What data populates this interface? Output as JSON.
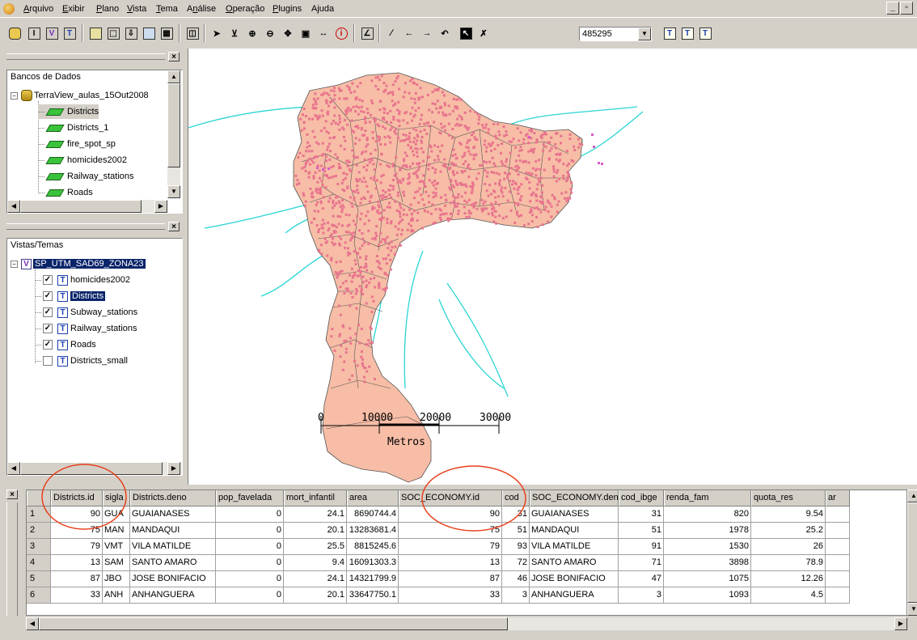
{
  "menu": [
    {
      "label": "Arquivo",
      "u": "A"
    },
    {
      "label": "Exibir",
      "u": "E"
    },
    {
      "label": "Plano",
      "u": "P"
    },
    {
      "label": "Vista",
      "u": "V"
    },
    {
      "label": "Tema",
      "u": "T"
    },
    {
      "label": "Análise",
      "u": "n"
    },
    {
      "label": "Operação",
      "u": "O"
    },
    {
      "label": "Plugins",
      "u": "P"
    },
    {
      "label": "Ajuda",
      "u": "j"
    }
  ],
  "window_controls": {
    "minimize": "_",
    "restore": "▫"
  },
  "toolbar": {
    "scale_value": "485295"
  },
  "database_panel": {
    "title": "Bancos de Dados",
    "database": "TerraView_aulas_15Out2008",
    "layers": [
      "Districts",
      "Districts_1",
      "fire_spot_sp",
      "homicides2002",
      "Railway_stations",
      "Roads"
    ]
  },
  "views_panel": {
    "title": "Vistas/Temas",
    "view": "SP_UTM_SAD69_ZONA23",
    "themes": [
      {
        "name": "homicides2002",
        "checked": true
      },
      {
        "name": "Districts",
        "checked": true
      },
      {
        "name": "Subway_stations",
        "checked": true
      },
      {
        "name": "Railway_stations",
        "checked": true
      },
      {
        "name": "Roads",
        "checked": true
      },
      {
        "name": "Districts_small",
        "checked": false
      }
    ]
  },
  "scale_bar": {
    "ticks": [
      "0",
      "10000",
      "20000",
      "30000"
    ],
    "unit": "Metros"
  },
  "colors": {
    "district_fill": "#f7bda6",
    "point_color": "#e8748e",
    "road_color": "#2ad4d4",
    "selection": "#0a246a",
    "annotation_circle": "#e8401c"
  },
  "table": {
    "columns": [
      "Districts.id",
      "sigla",
      "Districts.deno",
      "pop_favelada",
      "mort_infantil",
      "area",
      "SOC_ECONOMY.id",
      "cod",
      "SOC_ECONOMY.deno",
      "cod_ibge",
      "renda_fam",
      "quota_res",
      "ar"
    ],
    "rows": [
      {
        "n": "1",
        "cells": [
          "90",
          "GUA",
          "GUAIANASES",
          "0",
          "24.1",
          "8690744.4",
          "90",
          "31",
          "GUAIANASES",
          "31",
          "820",
          "9.54",
          ""
        ]
      },
      {
        "n": "2",
        "cells": [
          "75",
          "MAN",
          "MANDAQUI",
          "0",
          "20.1",
          "13283681.4",
          "75",
          "51",
          "MANDAQUI",
          "51",
          "1978",
          "25.2",
          ""
        ]
      },
      {
        "n": "3",
        "cells": [
          "79",
          "VMT",
          "VILA MATILDE",
          "0",
          "25.5",
          "8815245.6",
          "79",
          "93",
          "VILA MATILDE",
          "91",
          "1530",
          "26",
          ""
        ]
      },
      {
        "n": "4",
        "cells": [
          "13",
          "SAM",
          "SANTO AMARO",
          "0",
          "9.4",
          "16091303.3",
          "13",
          "72",
          "SANTO AMARO",
          "71",
          "3898",
          "78.9",
          ""
        ]
      },
      {
        "n": "5",
        "cells": [
          "87",
          "JBO",
          "JOSE BONIFACIO",
          "0",
          "24.1",
          "14321799.9",
          "87",
          "46",
          "JOSE BONIFACIO",
          "47",
          "1075",
          "12.26",
          ""
        ]
      },
      {
        "n": "6",
        "cells": [
          "33",
          "ANH",
          "ANHANGUERA",
          "0",
          "20.1",
          "33647750.1",
          "33",
          "3",
          "ANHANGUERA",
          "3",
          "1093",
          "4.5",
          ""
        ]
      }
    ]
  }
}
